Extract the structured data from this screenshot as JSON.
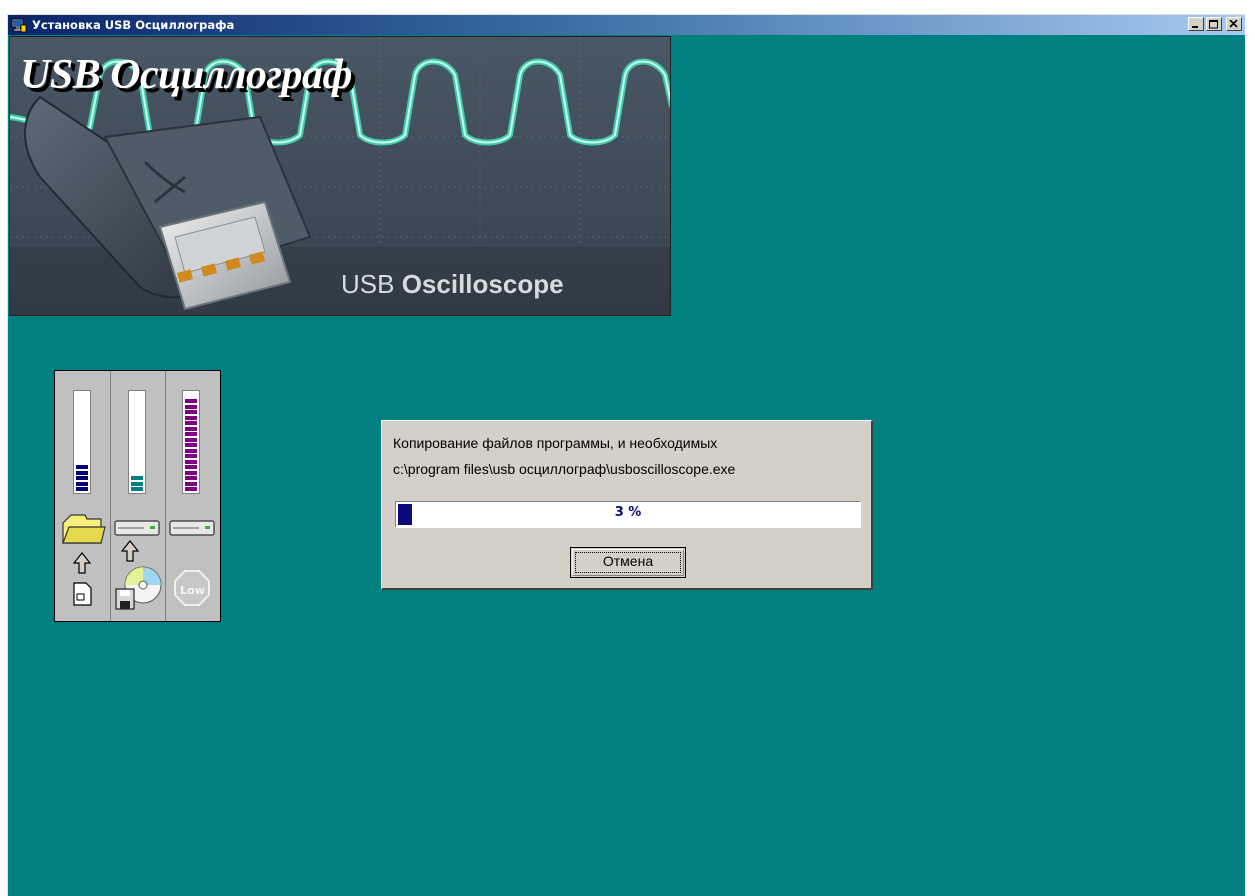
{
  "window": {
    "title": "Установка USB Осциллографа"
  },
  "banner": {
    "title": "USB Осциллограф",
    "subtitle_prefix": "USB",
    "subtitle_bold": "Oscilloscope"
  },
  "gauges": {
    "items": [
      {
        "name": "destination-folder",
        "fill_fraction": 0.25,
        "color": "#000080"
      },
      {
        "name": "hard-disk",
        "fill_fraction": 0.18,
        "color": "#008080"
      },
      {
        "name": "memory",
        "fill_fraction": 0.97,
        "color": "#800080"
      }
    ],
    "low_label": "Low"
  },
  "dialog": {
    "line1": "Копирование файлов программы, и необходимых",
    "line2": "c:\\program files\\usb осциллограф\\usboscilloscope.exe",
    "progress_percent": 3,
    "progress_text": "3 %",
    "cancel_label": "Отмена"
  },
  "colors": {
    "desktop": "#008080",
    "title_start": "#0a246a",
    "title_end": "#a6caf0",
    "progress": "#0a0a7a"
  }
}
